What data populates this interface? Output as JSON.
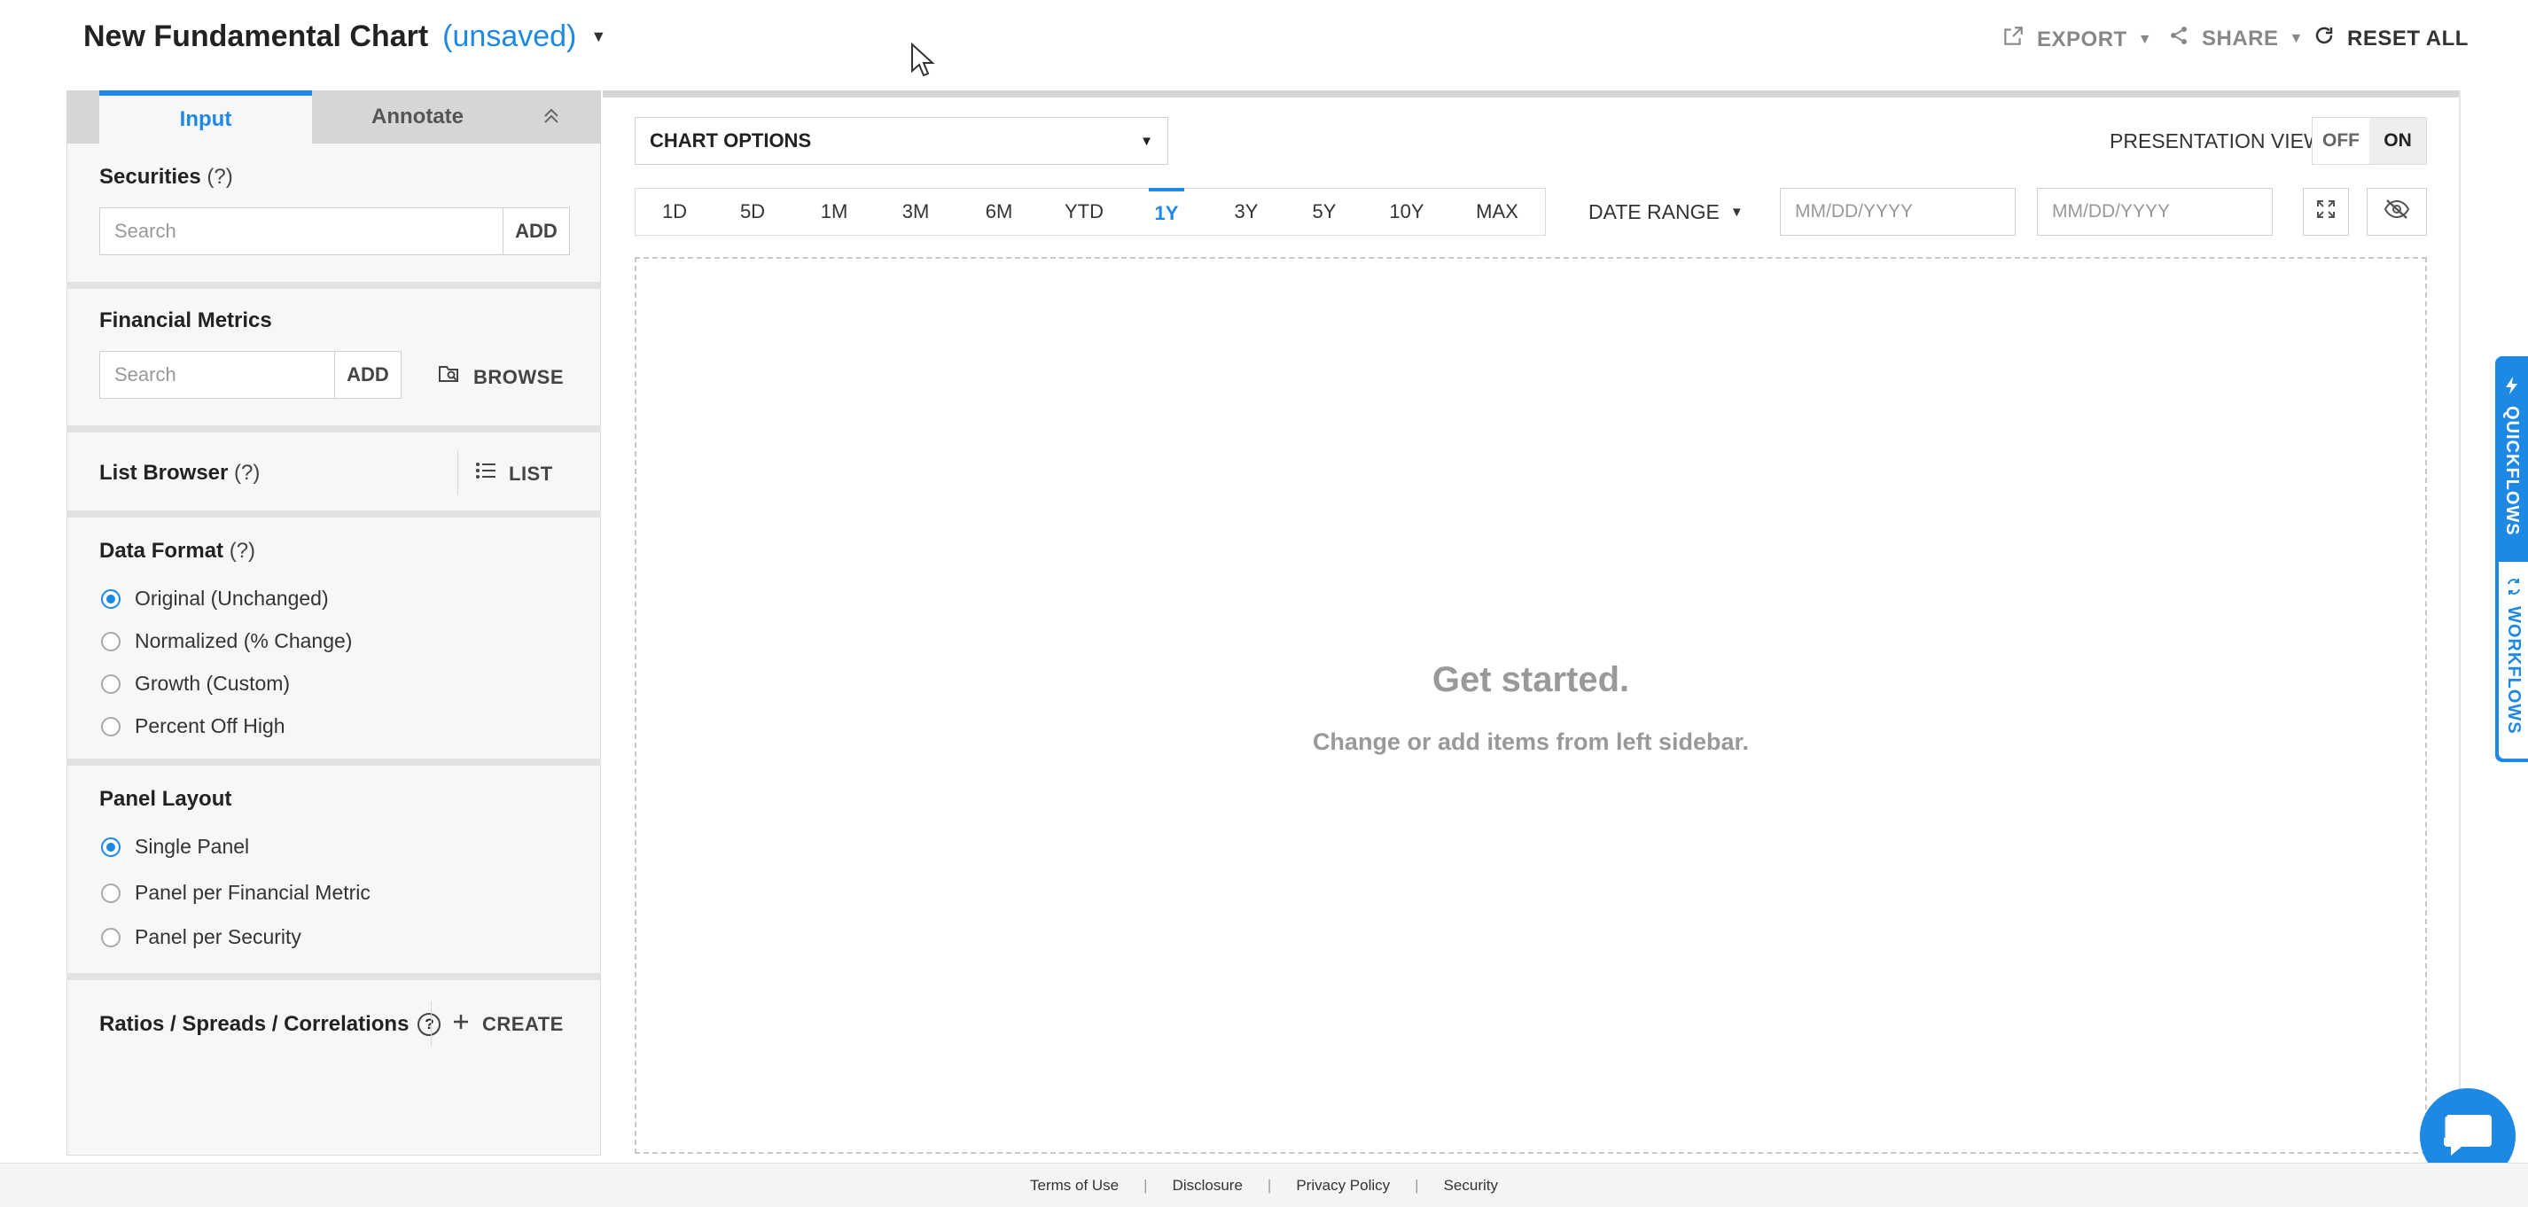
{
  "header": {
    "title": "New Fundamental Chart",
    "status": "(unsaved)",
    "export_label": "EXPORT",
    "share_label": "SHARE",
    "reset_label": "RESET ALL"
  },
  "sidebar": {
    "tabs": [
      {
        "label": "Input"
      },
      {
        "label": "Annotate"
      }
    ],
    "securities": {
      "label": "Securities",
      "help": "(?)",
      "placeholder": "Search",
      "add_label": "ADD"
    },
    "financial_metrics": {
      "label": "Financial Metrics",
      "placeholder": "Search",
      "add_label": "ADD",
      "browse_label": "BROWSE"
    },
    "list_browser": {
      "label": "List Browser",
      "help": "(?)",
      "list_label": "LIST"
    },
    "data_format": {
      "label": "Data Format",
      "help": "(?)",
      "options": [
        {
          "label": "Original (Unchanged)",
          "selected": true
        },
        {
          "label": "Normalized (% Change)",
          "selected": false
        },
        {
          "label": "Growth (Custom)",
          "selected": false
        },
        {
          "label": "Percent Off High",
          "selected": false
        }
      ]
    },
    "panel_layout": {
      "label": "Panel Layout",
      "options": [
        {
          "label": "Single Panel",
          "selected": true
        },
        {
          "label": "Panel per Financial Metric",
          "selected": false
        },
        {
          "label": "Panel per Security",
          "selected": false
        }
      ]
    },
    "ratios": {
      "label": "Ratios / Spreads / Correlations",
      "help": "?",
      "create_label": "CREATE"
    }
  },
  "main": {
    "chart_options_label": "CHART OPTIONS",
    "presentation_view": {
      "label": "PRESENTATION VIEW",
      "off": "OFF",
      "on": "ON",
      "value": "ON"
    },
    "ranges": [
      "1D",
      "5D",
      "1M",
      "3M",
      "6M",
      "YTD",
      "1Y",
      "3Y",
      "5Y",
      "10Y",
      "MAX"
    ],
    "active_range": "1Y",
    "date_range_label": "DATE RANGE",
    "start_date_placeholder": "MM/DD/YYYY",
    "end_date_placeholder": "MM/DD/YYYY",
    "empty_title": "Get started.",
    "empty_subtitle": "Change or add items from left sidebar."
  },
  "rail": {
    "quickflows": "QUICKFLOWS",
    "workflows": "WORKFLOWS"
  },
  "footer": {
    "links": [
      "Terms of Use",
      "Disclosure",
      "Privacy Policy",
      "Security"
    ]
  },
  "colors": {
    "accent": "#1e88e5",
    "muted": "#999999",
    "sidebar_bg": "#f7f7f7"
  },
  "icons": {
    "export": "external-link-icon",
    "share": "share-icon",
    "reset": "refresh-icon",
    "browse": "folder-search-icon",
    "list": "list-icon",
    "expand": "expand-icon",
    "hide": "eye-off-icon",
    "chat": "chat-icon"
  }
}
